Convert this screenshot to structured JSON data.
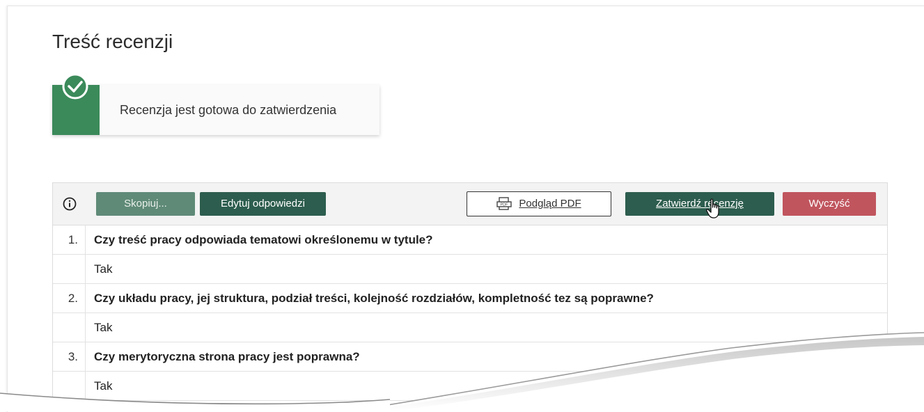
{
  "page": {
    "title": "Treść recenzji"
  },
  "alert": {
    "icon": "check-circle-icon",
    "text": "Recenzja jest gotowa do zatwierdzenia",
    "accent_color": "#3b8a5a"
  },
  "toolbar": {
    "info_icon": "info-icon",
    "copy_label": "Skopiuj...",
    "edit_label": "Edytuj odpowiedzi",
    "pdf_label": "Podgląd PDF",
    "pdf_icon": "pdf-icon",
    "confirm_label": "Zatwierdź recenzję",
    "clear_label": "Wyczyść",
    "colors": {
      "primary": "#2d5d4e",
      "secondary": "#5f8a78",
      "danger": "#c0555e"
    }
  },
  "questions": [
    {
      "number": "1.",
      "question": "Czy treść pracy odpowiada tematowi określonemu w tytule?",
      "answer": "Tak"
    },
    {
      "number": "2.",
      "question": "Czy układu pracy, jej struktura, podział treści, kolejność rozdziałów, kompletność tez są poprawne?",
      "answer": "Tak"
    },
    {
      "number": "3.",
      "question": "Czy merytoryczna strona pracy jest poprawna?",
      "answer": "Tak"
    }
  ]
}
